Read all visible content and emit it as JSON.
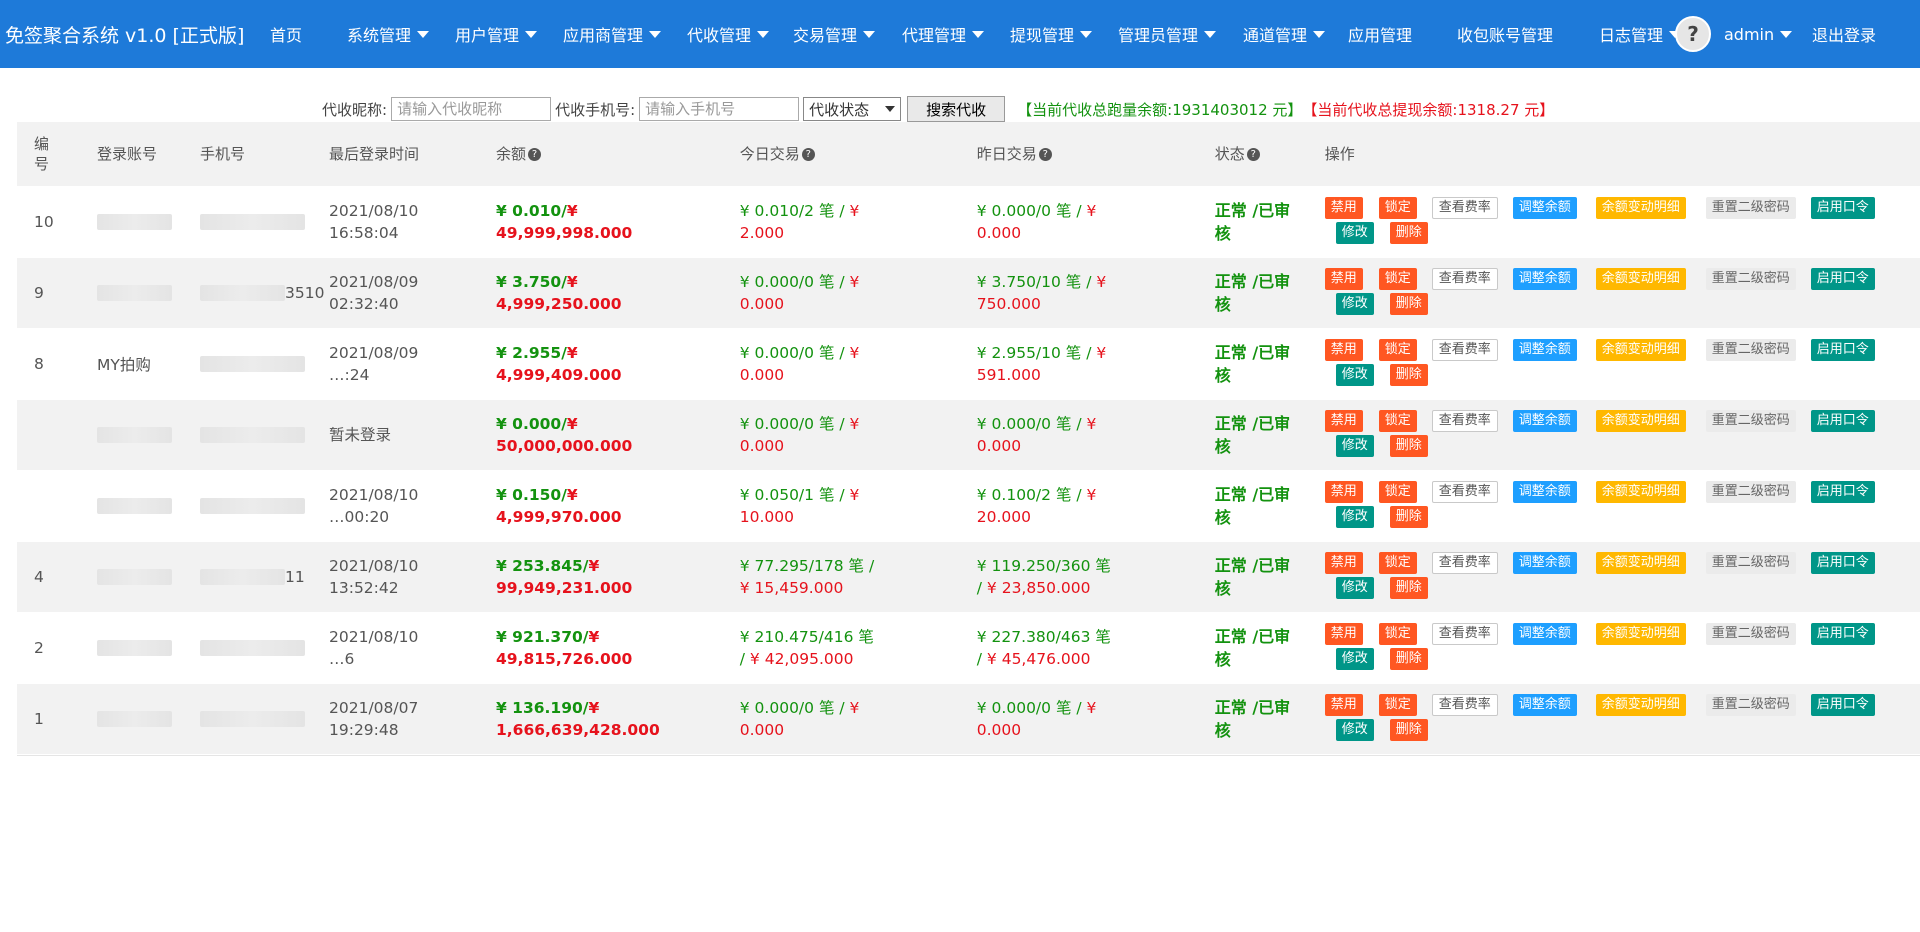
{
  "app": {
    "title": "免签聚合系统 v1.0 [正式版]",
    "accent": "#1e7ad9"
  },
  "nav": [
    {
      "label": "首页",
      "dropdown": false
    },
    {
      "label": "系统管理",
      "dropdown": true
    },
    {
      "label": "用户管理",
      "dropdown": true
    },
    {
      "label": "应用商管理",
      "dropdown": true
    },
    {
      "label": "代收管理",
      "dropdown": true
    },
    {
      "label": "交易管理",
      "dropdown": true
    },
    {
      "label": "代理管理",
      "dropdown": true
    },
    {
      "label": "提现管理",
      "dropdown": true
    },
    {
      "label": "管理员管理",
      "dropdown": true
    },
    {
      "label": "通道管理",
      "dropdown": true
    },
    {
      "label": "应用管理",
      "dropdown": false
    },
    {
      "label": "收包账号管理",
      "dropdown": false
    },
    {
      "label": "日志管理",
      "dropdown": true
    }
  ],
  "user": {
    "avatar_icon": "user-avatar-icon",
    "name": "admin",
    "logout": "退出登录"
  },
  "search": {
    "nickname_label": "代收昵称:",
    "nickname_placeholder": "请输入代收昵称",
    "phone_label": "代收手机号:",
    "phone_placeholder": "请输入手机号",
    "status_select": "代收状态",
    "search_button": "搜索代收",
    "total_running_balance": "【当前代收总跑量余额:1931403012 元】",
    "total_withdraw_balance": "【当前代收总提现余额:1318.27 元】"
  },
  "table": {
    "columns": [
      "编号",
      "登录账号",
      "手机号",
      "最后登录时间",
      "余额",
      "今日交易",
      "昨日交易",
      "状态",
      "操作"
    ],
    "actions": [
      "禁用",
      "锁定",
      "查看费率",
      "调整余额",
      "余额变动明细",
      "重置二级密码",
      "启用口令",
      "修改",
      "删除"
    ],
    "rows": [
      {
        "id": "10",
        "account": "",
        "phone": "",
        "login_line1": "2021/08/10",
        "login_line2": "16:58:04",
        "bal_g": "¥ 0.010/",
        "bal_r": "¥ 49,999,998.000",
        "today_g": "¥ 0.010/2 笔 / ",
        "today_r": "¥ 2.000",
        "yest_g": "¥ 0.000/0 笔 / ",
        "yest_r": "¥ 0.000",
        "status": "正常 /已审核"
      },
      {
        "id": "9",
        "account": "",
        "phone": "3510",
        "login_line1": "2021/08/09",
        "login_line2": "02:32:40",
        "bal_g": "¥ 3.750/",
        "bal_r": "¥ 4,999,250.000",
        "today_g": "¥ 0.000/0 笔 / ",
        "today_r": "¥ 0.000",
        "yest_g": "¥ 3.750/10 笔 / ",
        "yest_r": "¥ 750.000",
        "status": "正常 /已审核"
      },
      {
        "id": "8",
        "account": "MY拍购",
        "phone": "",
        "login_line1": "2021/08/09",
        "login_line2": "…:24",
        "bal_g": "¥ 2.955/",
        "bal_r": "¥ 4,999,409.000",
        "today_g": "¥ 0.000/0 笔 / ",
        "today_r": "¥ 0.000",
        "yest_g": "¥ 2.955/10 笔 / ",
        "yest_r": "¥ 591.000",
        "status": "正常 /已审核"
      },
      {
        "id": "",
        "account": "",
        "phone": "",
        "login_line1": "暂未登录",
        "login_line2": "",
        "bal_g": "¥ 0.000/",
        "bal_r": "¥ 50,000,000.000",
        "today_g": "¥ 0.000/0 笔 / ",
        "today_r": "¥ 0.000",
        "yest_g": "¥ 0.000/0 笔 / ",
        "yest_r": "¥ 0.000",
        "status": "正常 /已审核"
      },
      {
        "id": "",
        "account": "",
        "phone": "",
        "login_line1": "2021/08/10",
        "login_line2": "…00:20",
        "bal_g": "¥ 0.150/",
        "bal_r": "¥ 4,999,970.000",
        "today_g": "¥ 0.050/1 笔 / ",
        "today_r": "¥ 10.000",
        "yest_g": "¥ 0.100/2 笔 / ",
        "yest_r": "¥ 20.000",
        "status": "正常 /已审核"
      },
      {
        "id": "4",
        "account": "",
        "phone": "11",
        "login_line1": "2021/08/10",
        "login_line2": "13:52:42",
        "bal_g": "¥ 253.845/",
        "bal_r": "¥ 99,949,231.000",
        "today_g": "¥ 77.295/178 笔 / ",
        "today_r": "¥ 15,459.000",
        "yest_g": "¥ 119.250/360 笔 / ",
        "yest_r": "¥ 23,850.000",
        "status": "正常 /已审核"
      },
      {
        "id": "2",
        "account": "",
        "phone": "",
        "login_line1": "2021/08/10",
        "login_line2": "…6",
        "bal_g": "¥ 921.370/",
        "bal_r": "¥ 49,815,726.000",
        "today_g": "¥ 210.475/416 笔 / ",
        "today_r": "¥ 42,095.000",
        "yest_g": "¥ 227.380/463 笔 / ",
        "yest_r": "¥ 45,476.000",
        "status": "正常 /已审核"
      },
      {
        "id": "1",
        "account": "",
        "phone": "",
        "login_line1": "2021/08/07",
        "login_line2": "19:29:48",
        "bal_g": "¥ 136.190/",
        "bal_r": "¥ 1,666,639,428.000",
        "today_g": "¥ 0.000/0 笔 / ",
        "today_r": "¥ 0.000",
        "yest_g": "¥ 0.000/0 笔 / ",
        "yest_r": "¥ 0.000",
        "status": "正常 /已审核"
      }
    ]
  },
  "colors": {
    "header": "#1e7ad9",
    "green": "#13920f",
    "red": "#e6121c",
    "btn_orange": "#ff5722",
    "btn_blue": "#1e9fff",
    "btn_yellow": "#ffb800",
    "btn_teal": "#009688"
  }
}
